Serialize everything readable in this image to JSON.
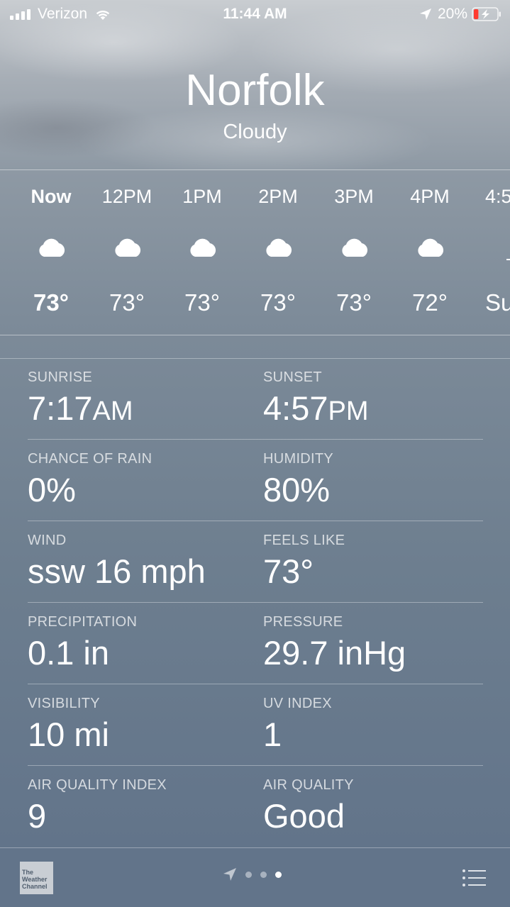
{
  "status_bar": {
    "carrier": "Verizon",
    "time": "11:44 AM",
    "battery_percent": "20%",
    "battery_level": 0.2,
    "battery_color": "#ff3b30"
  },
  "location": {
    "city": "Norfolk",
    "condition": "Cloudy"
  },
  "hourly": [
    {
      "label": "Now",
      "temp": "73°",
      "icon": "cloud-icon"
    },
    {
      "label": "12PM",
      "temp": "73°",
      "icon": "cloud-icon"
    },
    {
      "label": "1PM",
      "temp": "73°",
      "icon": "cloud-icon"
    },
    {
      "label": "2PM",
      "temp": "73°",
      "icon": "cloud-icon"
    },
    {
      "label": "3PM",
      "temp": "73°",
      "icon": "cloud-icon"
    },
    {
      "label": "4PM",
      "temp": "72°",
      "icon": "cloud-icon"
    },
    {
      "label": "4:5",
      "temp": "Su",
      "icon": "sunset-icon"
    }
  ],
  "details": [
    {
      "left": {
        "label": "SUNRISE",
        "value": "7:17",
        "suffix": "AM"
      },
      "right": {
        "label": "SUNSET",
        "value": "4:57",
        "suffix": "PM"
      }
    },
    {
      "left": {
        "label": "CHANCE OF RAIN",
        "value": "0%"
      },
      "right": {
        "label": "HUMIDITY",
        "value": "80%"
      }
    },
    {
      "left": {
        "label": "WIND",
        "value": "ssw 16 mph"
      },
      "right": {
        "label": "FEELS LIKE",
        "value": "73°"
      }
    },
    {
      "left": {
        "label": "PRECIPITATION",
        "value": "0.1 in"
      },
      "right": {
        "label": "PRESSURE",
        "value": "29.7 inHg"
      }
    },
    {
      "left": {
        "label": "VISIBILITY",
        "value": "10 mi"
      },
      "right": {
        "label": "UV INDEX",
        "value": "1"
      }
    },
    {
      "left": {
        "label": "AIR QUALITY INDEX",
        "value": "9"
      },
      "right": {
        "label": "AIR QUALITY",
        "value": "Good"
      }
    }
  ],
  "bottom_bar": {
    "logo_text": "The Weather Channel",
    "page_count": 3,
    "active_page": 3
  }
}
